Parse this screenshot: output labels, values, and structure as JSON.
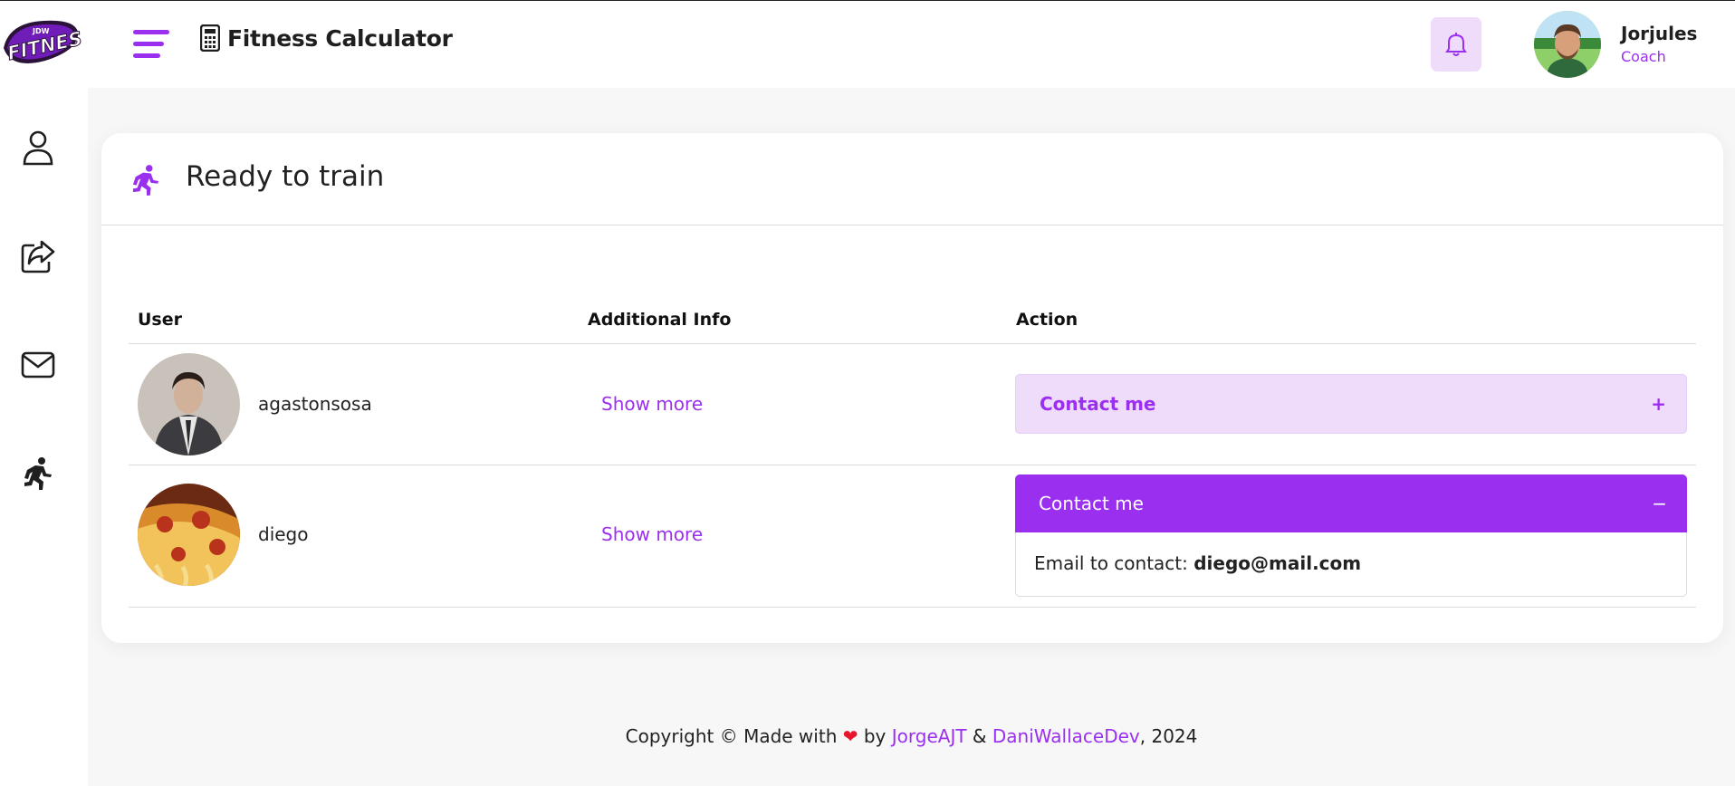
{
  "header": {
    "title": "Fitness Calculator",
    "user": {
      "name": "Jorjules",
      "role": "Coach"
    }
  },
  "logo": {
    "text_top": "JDW",
    "text_main": "FITNESS"
  },
  "sidebar": {
    "items": [
      {
        "icon": "user-icon"
      },
      {
        "icon": "share-icon"
      },
      {
        "icon": "mail-icon"
      },
      {
        "icon": "run-icon"
      }
    ]
  },
  "card": {
    "title": "Ready to train",
    "columns": [
      "User",
      "Additional Info",
      "Action"
    ],
    "rows": [
      {
        "user": "agastonsosa",
        "info": "Show more",
        "action": "Contact me",
        "toggle": "+",
        "expanded": false
      },
      {
        "user": "diego",
        "info": "Show more",
        "action": "Contact me",
        "toggle": "−",
        "expanded": true,
        "email_label": "Email to contact:",
        "email": "diego@mail.com"
      }
    ]
  },
  "footer": {
    "prefix": "Copyright © Made with",
    "by": "by",
    "author1": "JorgeAJT",
    "amp": "&",
    "author2": "DaniWallaceDev",
    "year": ", 2024"
  },
  "colors": {
    "accent": "#9b2ff0",
    "accent_light": "#efdcfb",
    "background": "#f7f7f8"
  }
}
